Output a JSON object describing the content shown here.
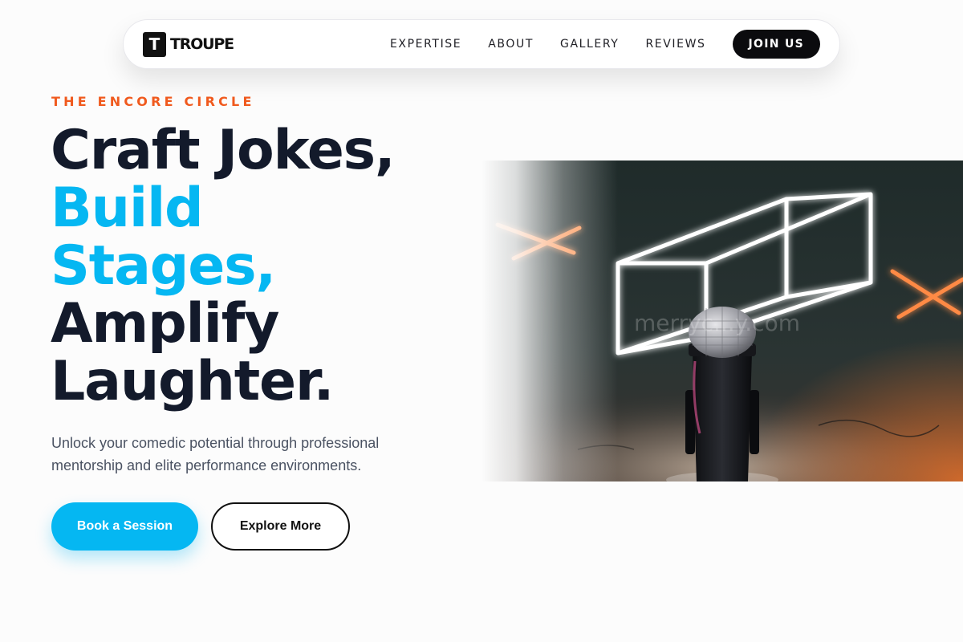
{
  "nav": {
    "brand_mark": "T",
    "brand_name": "TROUPE",
    "links": [
      {
        "label": "EXPERTISE"
      },
      {
        "label": "ABOUT"
      },
      {
        "label": "GALLERY"
      },
      {
        "label": "REVIEWS"
      }
    ],
    "join_label": "JOIN US"
  },
  "hero": {
    "eyebrow": "THE ENCORE CIRCLE",
    "headline": {
      "line1": "Craft Jokes,",
      "line2": "Build",
      "line3": "Stages,",
      "line4": "Amplify",
      "line5": "Laughter."
    },
    "subtext": "Unlock your comedic potential through professional mentorship and elite performance environments.",
    "primary_button": "Book a Session",
    "secondary_button": "Explore More",
    "image": {
      "subject": "microphone on stage with neon lights",
      "watermark": "merryc...y.com"
    }
  },
  "colors": {
    "accent_blue": "#05b7f2",
    "accent_orange": "#f05a1e",
    "heading_dark": "#131a2b",
    "background": "#fcfcfc"
  }
}
